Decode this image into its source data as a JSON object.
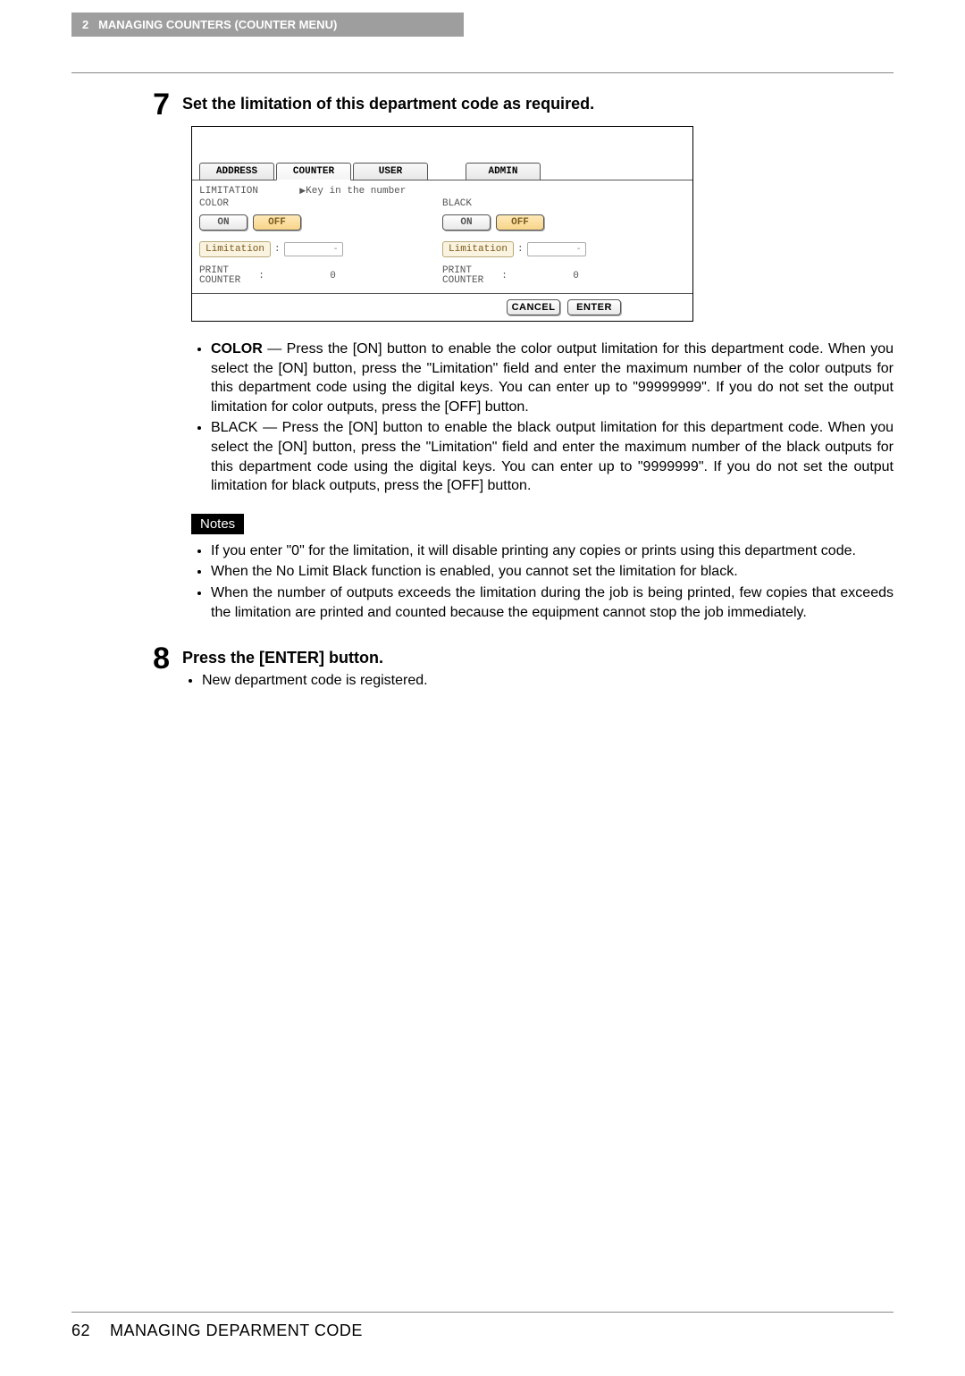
{
  "header": {
    "chapter_num": "2",
    "chapter_title": "MANAGING COUNTERS (COUNTER MENU)"
  },
  "step7": {
    "num": "7",
    "title": "Set the limitation of this department code as required."
  },
  "panel": {
    "tabs": {
      "address": "ADDRESS",
      "counter": "COUNTER",
      "user": "USER",
      "admin": "ADMIN"
    },
    "limitation_label": "LIMITATION",
    "hint": "Key in the number",
    "color_label": "COLOR",
    "black_label": "BLACK",
    "on": "ON",
    "off": "OFF",
    "limitation_field": "Limitation",
    "dash": "-",
    "print_counter": "PRINT\nCOUNTER",
    "zero": "0",
    "cancel": "CANCEL",
    "enter": "ENTER"
  },
  "body": {
    "color_bullet": "COLOR — Press the [ON] button to enable the color output limitation for this department code. When you select the [ON] button, press the \"Limitation\" field and enter the maximum number of the color outputs for this department code using the digital keys. You can enter up to \"99999999\". If you do not set the output limitation for color outputs, press the [OFF] button.",
    "color_lead": "COLOR",
    "black_bullet": "BLACK — Press the [ON] button to enable the black output limitation for this department code. When you select the [ON] button, press the \"Limitation\" field and enter the maximum number of the black outputs for this department code using the digital keys. You can enter up to \"9999999\". If you do not set the output limitation for black outputs, press the [OFF] button.",
    "notes_label": "Notes",
    "note1": "If you enter \"0\" for the limitation, it will disable printing any copies or prints using this department code.",
    "note2": "When the No Limit Black function is enabled, you cannot set the limitation for black.",
    "note3": "When the number of outputs exceeds the limitation during the job is being printed, few copies that exceeds the limitation are printed and counted because the equipment cannot stop the job immediately."
  },
  "step8": {
    "num": "8",
    "title": "Press the [ENTER] button.",
    "bullet": "New department code is registered."
  },
  "footer": {
    "page_num": "62",
    "title": "MANAGING DEPARMENT CODE"
  }
}
